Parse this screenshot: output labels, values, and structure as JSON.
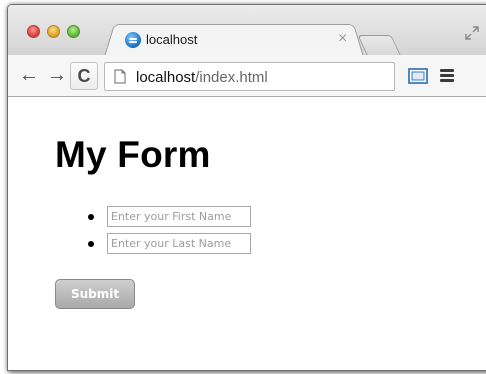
{
  "browser": {
    "tab_title": "localhost",
    "tab_close": "×",
    "url_host": "localhost",
    "url_path": "/index.html",
    "nav_back": "←",
    "nav_forward": "→",
    "reload": "C"
  },
  "page": {
    "heading": "My Form",
    "first_name_placeholder": "Enter your First Name",
    "last_name_placeholder": "Enter your Last Name",
    "submit_label": "Submit"
  },
  "colors": {
    "close": "#e0443e",
    "minimize": "#e0a529",
    "zoom": "#5fbd3a",
    "submit_bg": "#b5b5b5"
  }
}
